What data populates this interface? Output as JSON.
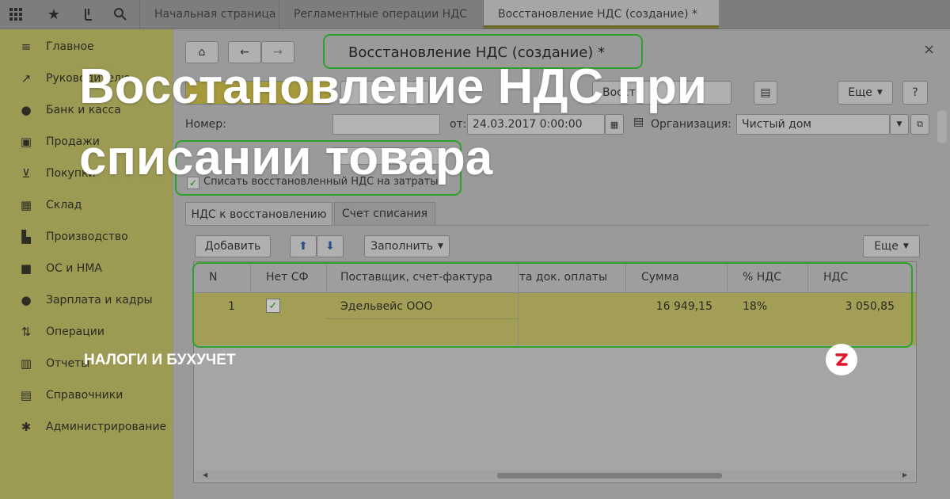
{
  "topbar": {
    "icons": [
      "grid-icon",
      "star-icon",
      "history-icon",
      "search-icon"
    ],
    "tabs": [
      {
        "label": "Начальная страница"
      },
      {
        "label": "Регламентные операции НДС"
      },
      {
        "label": "Восстановление НДС (создание) *"
      }
    ]
  },
  "sidebar": {
    "items": [
      {
        "label": "Главное",
        "icon": "menu-icon"
      },
      {
        "label": "Руководителю",
        "icon": "trend-icon"
      },
      {
        "label": "Банк и касса",
        "icon": "coin-icon"
      },
      {
        "label": "Продажи",
        "icon": "bag-icon"
      },
      {
        "label": "Покупки",
        "icon": "cart-icon"
      },
      {
        "label": "Склад",
        "icon": "warehouse-icon"
      },
      {
        "label": "Производство",
        "icon": "factory-icon"
      },
      {
        "label": "ОС и НМА",
        "icon": "truck-icon"
      },
      {
        "label": "Зарплата и кадры",
        "icon": "person-icon"
      },
      {
        "label": "Операции",
        "icon": "operations-icon"
      },
      {
        "label": "Отчеты",
        "icon": "bar-chart-icon"
      },
      {
        "label": "Справочники",
        "icon": "book-icon"
      },
      {
        "label": "Администрирование",
        "icon": "gear-icon"
      }
    ]
  },
  "form": {
    "title": "Восстановление НДС (создание) *",
    "buttons": {
      "restore": "Восст",
      "more": "Еще",
      "help": "?"
    },
    "number_label": "Номер:",
    "date_label": "от:",
    "date_value": "24.03.2017  0:00:00",
    "org_label": "Организация:",
    "org_value": "Чистый дом",
    "checkbox_label": "Списать восстановленный НДС на затраты",
    "checkbox_checked": true,
    "tabs": [
      "НДС к восстановлению",
      "Счет списания"
    ],
    "table_toolbar": {
      "add": "Добавить",
      "fill": "Заполнить",
      "more": "Еще"
    },
    "table": {
      "columns": [
        "N",
        "Нет СФ",
        "Поставщик, счет-фактура",
        "Дата док. оплаты",
        "Сумма",
        "% НДС",
        "НДС"
      ],
      "rows": [
        {
          "n": "1",
          "no_sf": true,
          "supplier": "Эдельвейс ООО",
          "pay_date": "",
          "sum": "16 949,15",
          "vat_rate": "18%",
          "vat": "3 050,85"
        }
      ]
    }
  },
  "overlay": {
    "headline_line1": "Восстановление НДС при",
    "headline_line2": "списании товара",
    "category": "НАЛОГИ И БУХУЧЕТ",
    "logo": "z-logo-icon"
  },
  "colors": {
    "highlight_green": "#2fa028",
    "sidebar_bg": "#9c9a53",
    "row_highlight": "#a39e55"
  }
}
